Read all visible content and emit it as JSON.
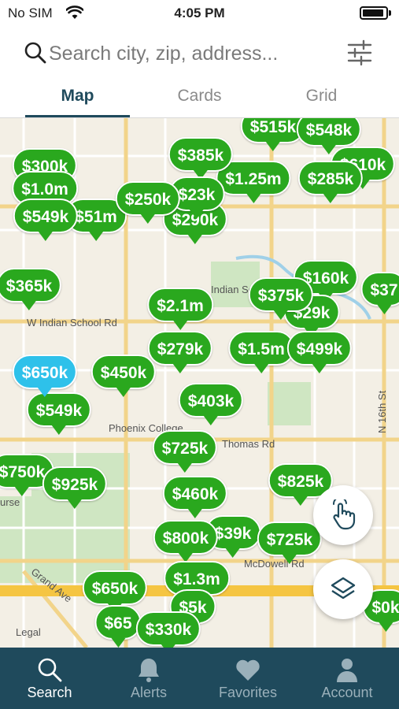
{
  "status_bar": {
    "carrier": "No SIM",
    "time": "4:05 PM"
  },
  "search": {
    "placeholder": "Search city, zip, address..."
  },
  "view_tabs": [
    {
      "label": "Map",
      "active": true
    },
    {
      "label": "Cards",
      "active": false
    },
    {
      "label": "Grid",
      "active": false
    }
  ],
  "map": {
    "street_labels": {
      "indian_school": "W Indian School Rd",
      "park": "Indian School Park",
      "thomas": "Thomas Rd",
      "phoenix_college": "Phoenix College",
      "mcdowell": "McDowell Rd",
      "grand_ave": "Grand Ave",
      "sixteenth": "N 16th St",
      "legal": "Legal",
      "course": "urse"
    },
    "pins": [
      "$515k",
      "$548k",
      "$300k",
      "$385k",
      "$610k",
      "$1.0m",
      "$1.25m",
      "$285k",
      "$250k",
      "$23k",
      "$549k",
      "$51m",
      "$290k",
      "$365k",
      "$160k",
      "$375k",
      "$37",
      "$2.1m",
      "$29k",
      "$279k",
      "$1.5m",
      "$499k",
      "$650k",
      "$450k",
      "$549k",
      "$403k",
      "$725k",
      "$750k",
      "$925k",
      "$825k",
      "$460k",
      "$39k",
      "$800k",
      "$725k",
      "$650k",
      "$1.3m",
      "$65",
      "$330k",
      "$5k",
      "$0k"
    ],
    "selected_pin": "$650k"
  },
  "controls": {
    "draw_icon": "hand-draw-icon",
    "layers_icon": "layers-icon"
  },
  "colors": {
    "pin_green": "#2aa81e",
    "pin_selected": "#2ec1ea",
    "nav_bg": "#1f4a5c",
    "tab_active": "#1f4a5c"
  },
  "bottom_nav": [
    {
      "label": "Search",
      "icon": "search-icon",
      "active": true
    },
    {
      "label": "Alerts",
      "icon": "bell-icon",
      "active": false
    },
    {
      "label": "Favorites",
      "icon": "heart-icon",
      "active": false
    },
    {
      "label": "Account",
      "icon": "person-icon",
      "active": false
    }
  ]
}
